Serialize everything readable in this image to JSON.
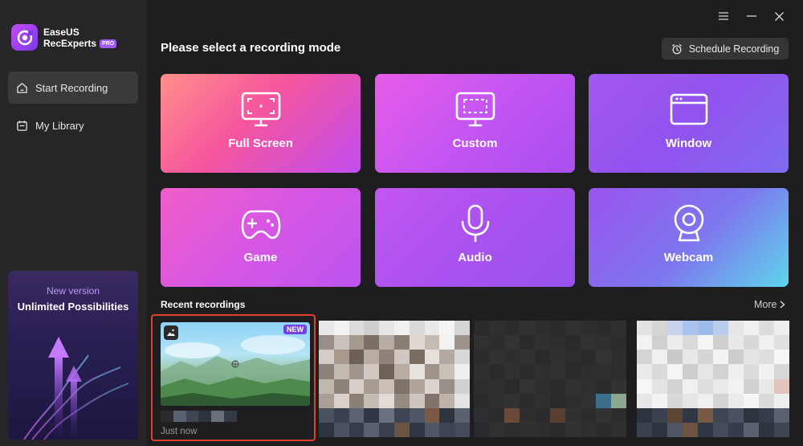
{
  "app": {
    "name_line1": "EaseUS",
    "name_line2": "RecExperts",
    "edition_badge": "PRO"
  },
  "sidebar": {
    "items": [
      {
        "label": "Start Recording",
        "icon": "home-icon",
        "active": true
      },
      {
        "label": "My Library",
        "icon": "library-icon",
        "active": false
      }
    ],
    "promo": {
      "subtitle": "New version",
      "title": "Unlimited Possibilities"
    }
  },
  "window_controls": [
    "menu-icon",
    "minimize-icon",
    "close-icon"
  ],
  "header": {
    "title": "Please select a recording mode",
    "schedule_label": "Schedule Recording"
  },
  "modes": [
    {
      "label": "Full Screen",
      "icon": "monitor-fullscreen-icon"
    },
    {
      "label": "Custom",
      "icon": "monitor-custom-icon"
    },
    {
      "label": "Window",
      "icon": "window-icon"
    },
    {
      "label": "Game",
      "icon": "gamepad-icon"
    },
    {
      "label": "Audio",
      "icon": "microphone-icon"
    },
    {
      "label": "Webcam",
      "icon": "webcam-icon"
    }
  ],
  "recent": {
    "title": "Recent recordings",
    "more_label": "More",
    "items": [
      {
        "badge": "NEW",
        "time": "Just now",
        "type_icon": "image-icon"
      }
    ]
  },
  "colors": {
    "background": "#1e1e20",
    "sidebar": "#262628",
    "highlight_border": "#e0402f",
    "accent": "#9d5af0"
  }
}
